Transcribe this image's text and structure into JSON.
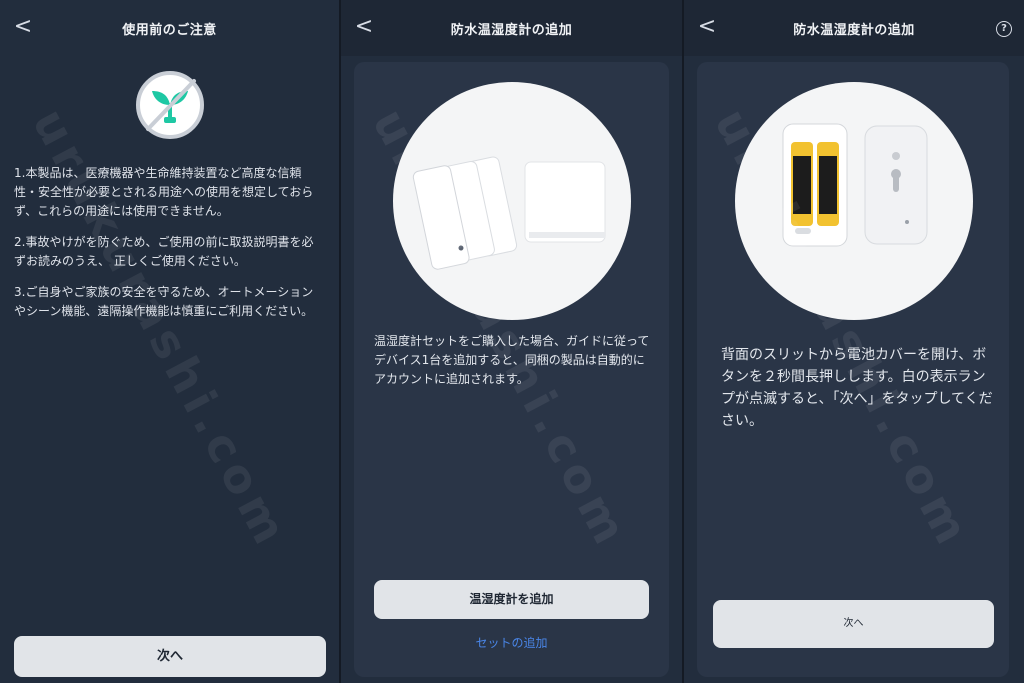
{
  "screens": [
    {
      "title": "使用前のご注意",
      "back_glyph": "<",
      "icon": "no-plant-icon",
      "notes": [
        "1.本製品は、医療機器や生命維持装置など高度な信頼性・安全性が必要とされる用途への使用を想定しておらず、これらの用途には使用できません。",
        "2.事故やけがを防ぐため、ご使用の前に取扱説明書を必ずお読みのうえ、 正しくご使用ください。",
        "3.ご自身やご家族の安全を守るため、オートメーションやシーン機能、遠隔操作機能は慎重にご利用ください。"
      ],
      "button": "次へ"
    },
    {
      "title": "防水温湿度計の追加",
      "back_glyph": "<",
      "image": "thermo-hygrometer-set-illustration",
      "description": "温湿度計セットをご購入した場合、ガイドに従ってデバイス1台を追加すると、同梱の製品は自動的にアカウントに追加されます。",
      "button": "温湿度計を追加",
      "link": "セットの追加"
    },
    {
      "title": "防水温湿度計の追加",
      "back_glyph": "<",
      "help_glyph": "?",
      "image": "battery-compartment-illustration",
      "description": "背面のスリットから電池カバーを開け、ボタンを２秒間長押しします。白の表示ランプが点滅すると、「次へ」をタップしてください。",
      "button": "次へ"
    }
  ],
  "watermark": "urukurashi.com",
  "colors": {
    "background": "#222d3d",
    "card": "#2a3547",
    "button": "#e1e4e8",
    "link": "#4a86e8",
    "battery": "#f2c230"
  }
}
